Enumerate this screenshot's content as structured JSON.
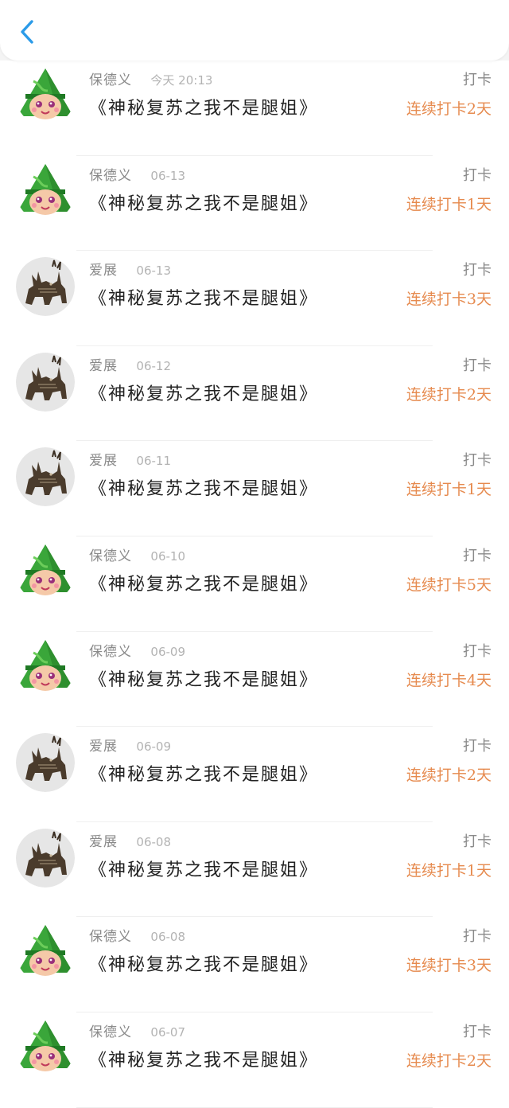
{
  "nav": {
    "back_icon": "chevron-left-icon",
    "accent_color": "#2b9be8"
  },
  "colors": {
    "streak": "#e68a4e",
    "muted": "#9a9a9a"
  },
  "entries": [
    {
      "avatar": "zongzi",
      "user": "保德义",
      "date": "今天 20:13",
      "title": "《神秘复苏之我不是腿姐》",
      "type": "打卡",
      "streak": "连续打卡2天"
    },
    {
      "avatar": "zongzi",
      "user": "保德义",
      "date": "06-13",
      "title": "《神秘复苏之我不是腿姐》",
      "type": "打卡",
      "streak": "连续打卡1天"
    },
    {
      "avatar": "bronze",
      "user": "爱展",
      "date": "06-13",
      "title": "《神秘复苏之我不是腿姐》",
      "type": "打卡",
      "streak": "连续打卡3天"
    },
    {
      "avatar": "bronze",
      "user": "爱展",
      "date": "06-12",
      "title": "《神秘复苏之我不是腿姐》",
      "type": "打卡",
      "streak": "连续打卡2天"
    },
    {
      "avatar": "bronze",
      "user": "爱展",
      "date": "06-11",
      "title": "《神秘复苏之我不是腿姐》",
      "type": "打卡",
      "streak": "连续打卡1天"
    },
    {
      "avatar": "zongzi",
      "user": "保德义",
      "date": "06-10",
      "title": "《神秘复苏之我不是腿姐》",
      "type": "打卡",
      "streak": "连续打卡5天"
    },
    {
      "avatar": "zongzi",
      "user": "保德义",
      "date": "06-09",
      "title": "《神秘复苏之我不是腿姐》",
      "type": "打卡",
      "streak": "连续打卡4天"
    },
    {
      "avatar": "bronze",
      "user": "爱展",
      "date": "06-09",
      "title": "《神秘复苏之我不是腿姐》",
      "type": "打卡",
      "streak": "连续打卡2天"
    },
    {
      "avatar": "bronze",
      "user": "爱展",
      "date": "06-08",
      "title": "《神秘复苏之我不是腿姐》",
      "type": "打卡",
      "streak": "连续打卡1天"
    },
    {
      "avatar": "zongzi",
      "user": "保德义",
      "date": "06-08",
      "title": "《神秘复苏之我不是腿姐》",
      "type": "打卡",
      "streak": "连续打卡3天"
    },
    {
      "avatar": "zongzi",
      "user": "保德义",
      "date": "06-07",
      "title": "《神秘复苏之我不是腿姐》",
      "type": "打卡",
      "streak": "连续打卡2天"
    }
  ]
}
